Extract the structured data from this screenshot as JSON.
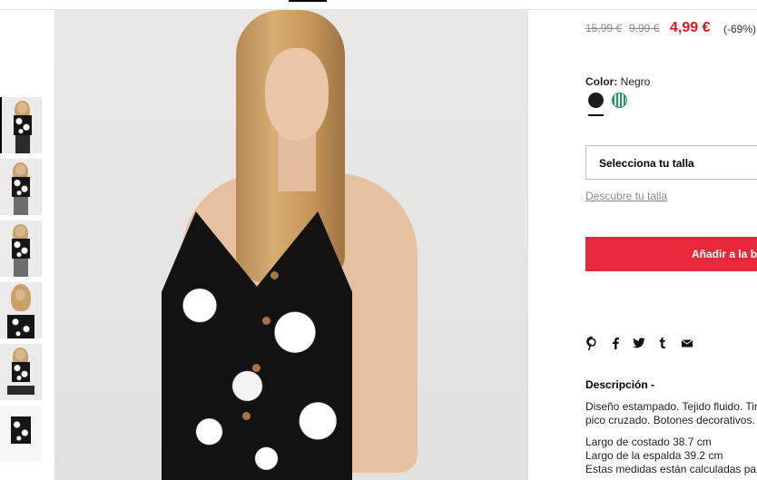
{
  "gallery": {
    "thumbnails": [
      "front",
      "full-body",
      "full-body-side",
      "close-up",
      "seated",
      "product"
    ]
  },
  "price": {
    "original_1": "15,99 €",
    "original_2": "9,99 €",
    "current": "4,99 €",
    "discount": "(-69%)"
  },
  "color": {
    "label": "Color:",
    "selected": "Negro",
    "swatches": [
      {
        "name": "Negro",
        "hex": "#1c1c1c"
      },
      {
        "name": "Verde",
        "hex": "#1d9b5a"
      }
    ]
  },
  "size": {
    "select_label": "Selecciona tu talla",
    "guide_link": "Descubre tu talla"
  },
  "cart": {
    "add_label": "Añadir a la bolsa"
  },
  "share_icons": [
    "pinterest-icon",
    "facebook-icon",
    "twitter-icon",
    "tumblr-icon",
    "email-icon"
  ],
  "description": {
    "title": "Descripción -",
    "lines": [
      "Diseño estampado. Tejido fluido. Tirantes finos.",
      "pico cruzado. Botones decorativos.",
      "Largo de costado 38.7 cm",
      "Largo de la espalda 39.2 cm",
      "Estas medidas están calculadas para una talla"
    ]
  },
  "colors": {
    "accent_red": "#e5141e",
    "button_red": "#e5283a"
  }
}
